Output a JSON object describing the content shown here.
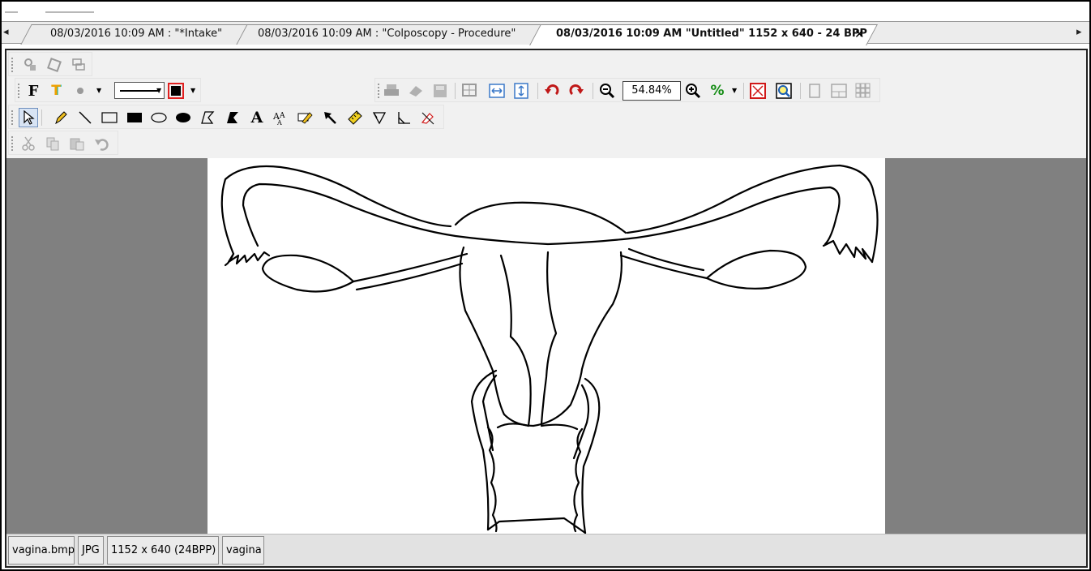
{
  "tabs": [
    {
      "label": "08/03/2016 10:09 AM : \"*Intake\"",
      "active": false
    },
    {
      "label": "08/03/2016 10:09 AM : \"Colposcopy - Procedure\"",
      "active": false
    },
    {
      "label": "08/03/2016 10:09 AM \"Untitled\" 1152 x 640 - 24 BPP",
      "active": true
    }
  ],
  "tab_close": "✕",
  "tab_scroll_left": "◂",
  "tab_scroll_right": "▸",
  "toolbar": {
    "zoom_value": "54.84%",
    "font_glyph": "F",
    "text_glyph": "T",
    "percent_glyph": "%",
    "text_tool_glyph": "A",
    "icons": [
      "scanner-icon",
      "stamp-icon",
      "layers-icon",
      "font-icon",
      "text-color-icon",
      "brush-size-icon",
      "line-style-select",
      "color-picker-icon",
      "print-icon",
      "scan-icon",
      "save-icon",
      "fit-icon",
      "fit-width-icon",
      "fit-height-icon",
      "rotate-left-icon",
      "rotate-right-icon",
      "zoom-out-icon",
      "zoom-in-icon",
      "percent-icon",
      "fullscreen-icon",
      "zoom-window-icon",
      "single-page-icon",
      "two-page-icon",
      "grid-view-icon",
      "select-tool-icon",
      "pencil-icon",
      "line-icon",
      "rectangle-icon",
      "filled-rectangle-icon",
      "ellipse-icon",
      "filled-ellipse-icon",
      "polygon-icon",
      "filled-polygon-icon",
      "text-tool-icon",
      "text-size-icon",
      "highlighter-icon",
      "arrow-icon",
      "ruler-icon",
      "angle-icon",
      "right-angle-icon",
      "eraser-icon",
      "cut-icon",
      "copy-icon",
      "paste-icon",
      "undo-icon"
    ]
  },
  "status": {
    "filename": "vagina.bmp",
    "format": "JPG",
    "dimensions": "1152 x 640 (24BPP)",
    "title": "vagina"
  },
  "colors": {
    "canvas_bg": "#808080",
    "page_bg": "#ffffff",
    "toolbar_bg": "#f0f0f0"
  }
}
